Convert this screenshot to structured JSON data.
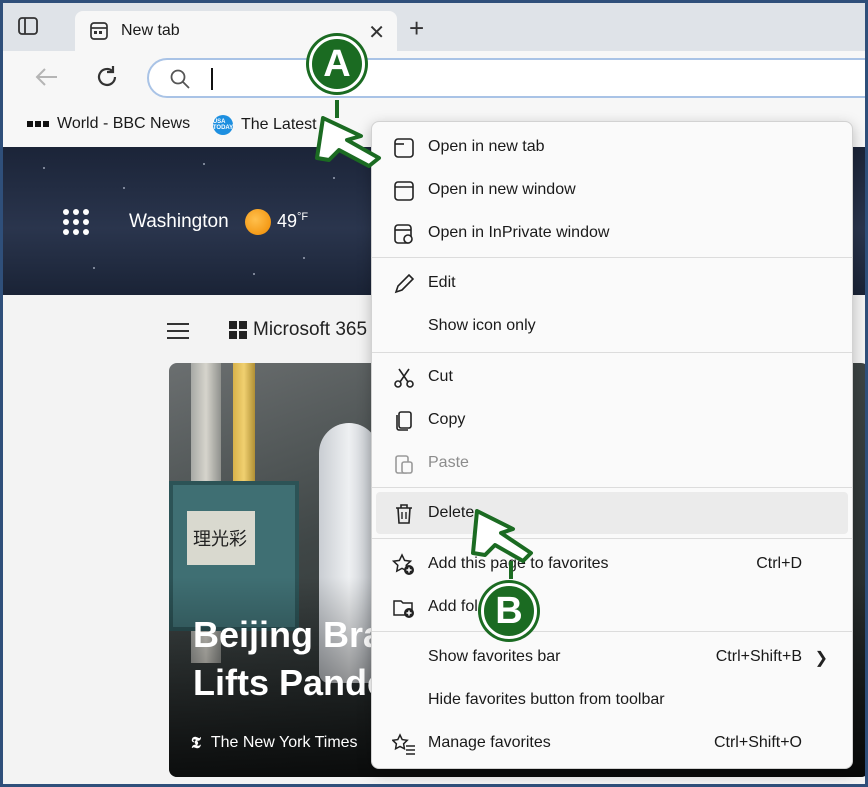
{
  "tabs": [
    {
      "title": "New tab",
      "close": "✕"
    }
  ],
  "newtab_label": "+",
  "favorites": [
    {
      "label": "World - BBC News",
      "icon": "bbc-icon"
    },
    {
      "label": "The Latest",
      "icon": "usa-today-icon",
      "icon_text": "USA TODAY"
    }
  ],
  "weather": {
    "city": "Washington",
    "temp": "49",
    "unit": "°F"
  },
  "feed": {
    "nav_label": "Microsoft 365",
    "headline_line1": "Beijing Bra",
    "headline_line2": "Lifts Pande",
    "source": "The New York Times",
    "sign_text": "理光彩"
  },
  "menu": {
    "items": [
      {
        "label": "Open in new tab",
        "icon": "new-tab-icon"
      },
      {
        "label": "Open in new window",
        "icon": "new-window-icon"
      },
      {
        "label": "Open in InPrivate window",
        "icon": "inprivate-icon"
      },
      {
        "label": "Edit",
        "icon": "pencil-icon"
      },
      {
        "label": "Show icon only"
      },
      {
        "label": "Cut",
        "icon": "scissors-icon"
      },
      {
        "label": "Copy",
        "icon": "copy-icon"
      },
      {
        "label": "Paste",
        "icon": "paste-icon",
        "disabled": true
      },
      {
        "label": "Delete",
        "icon": "trash-icon",
        "highlighted": true
      },
      {
        "label": "Add this page to favorites",
        "icon": "star-add-icon",
        "shortcut": "Ctrl+D"
      },
      {
        "label": "Add fol",
        "icon": "folder-add-icon"
      },
      {
        "label": "Show favorites bar",
        "shortcut": "Ctrl+Shift+B",
        "has_submenu": true
      },
      {
        "label": "Hide favorites button from toolbar"
      },
      {
        "label": "Manage favorites",
        "icon": "manage-favorites-icon",
        "shortcut": "Ctrl+Shift+O"
      }
    ]
  },
  "annotations": {
    "a": "A",
    "b": "B"
  },
  "colors": {
    "annotation_green": "#1b6b22",
    "frame_border": "#2f4f7a",
    "omnibox_border": "#a9c3e6"
  }
}
